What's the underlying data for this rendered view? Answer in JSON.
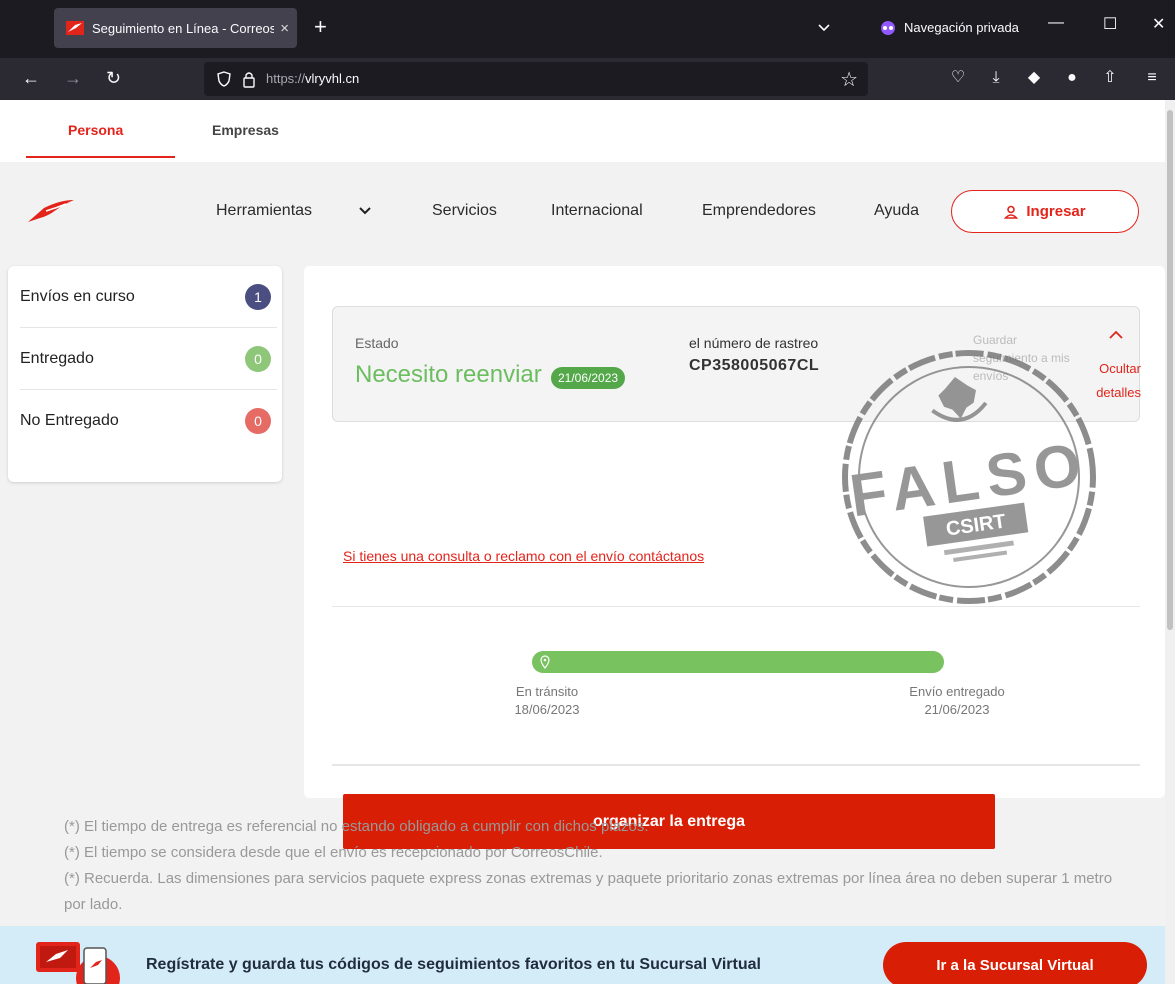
{
  "browser": {
    "tab_title": "Seguimiento en Línea - Correos",
    "tab_close": "×",
    "new_tab": "+",
    "private_label": "Navegación privada",
    "url_protocol": "https://",
    "url_host": "vlryvhl.cn",
    "window_min": "—",
    "window_max": "☐",
    "window_close": "✕"
  },
  "segment": {
    "persona": "Persona",
    "empresas": "Empresas"
  },
  "header": {
    "menu": [
      "Herramientas",
      "Servicios",
      "Internacional",
      "Emprendedores",
      "Ayuda"
    ],
    "ingresar": "Ingresar"
  },
  "sidebar": {
    "items": [
      {
        "label": "Envíos en curso",
        "count": "1",
        "color": "#4b4e80"
      },
      {
        "label": "Entregado",
        "count": "0",
        "color": "#8fc77a"
      },
      {
        "label": "No Entregado",
        "count": "0",
        "color": "#e56b64"
      }
    ]
  },
  "tracking": {
    "estado_label": "Estado",
    "status": "Necesito reenviar",
    "status_date": "21/06/2023",
    "number_label": "el número de rastreo",
    "number": "CP358005067CL",
    "save_text": "Guardar seguimiento a mis envíos",
    "hide_line1": "Ocultar",
    "hide_line2": "detalles",
    "contact_link": "Si tienes una consulta o reclamo con el envío contáctanos",
    "timeline": {
      "start_label": "En tránsito",
      "start_date": "18/06/2023",
      "end_label": "Envío entregado",
      "end_date": "21/06/2023"
    },
    "action_button": "organizar la entrega"
  },
  "notes": [
    "(*) El tiempo de entrega es referencial no estando obligado a cumplir con dichos plazos.",
    "(*) El tiempo se considera desde que el envío es recepcionado por CorreosChile.",
    "(*) Recuerda. Las dimensiones para servicios paquete express zonas extremas y paquete prioritario zonas extremas  por línea área no deben superar 1 metro por lado."
  ],
  "banner": {
    "message": "Regístrate y guarda tus códigos de seguimientos favoritos en tu Sucursal Virtual",
    "button": "Ir a la Sucursal Virtual"
  },
  "stamp": {
    "word": "FALSO",
    "org": "CSIRT"
  },
  "colors": {
    "brand_red": "#e2241b",
    "button_red": "#d81e05",
    "success_green": "#6bbd5f"
  }
}
